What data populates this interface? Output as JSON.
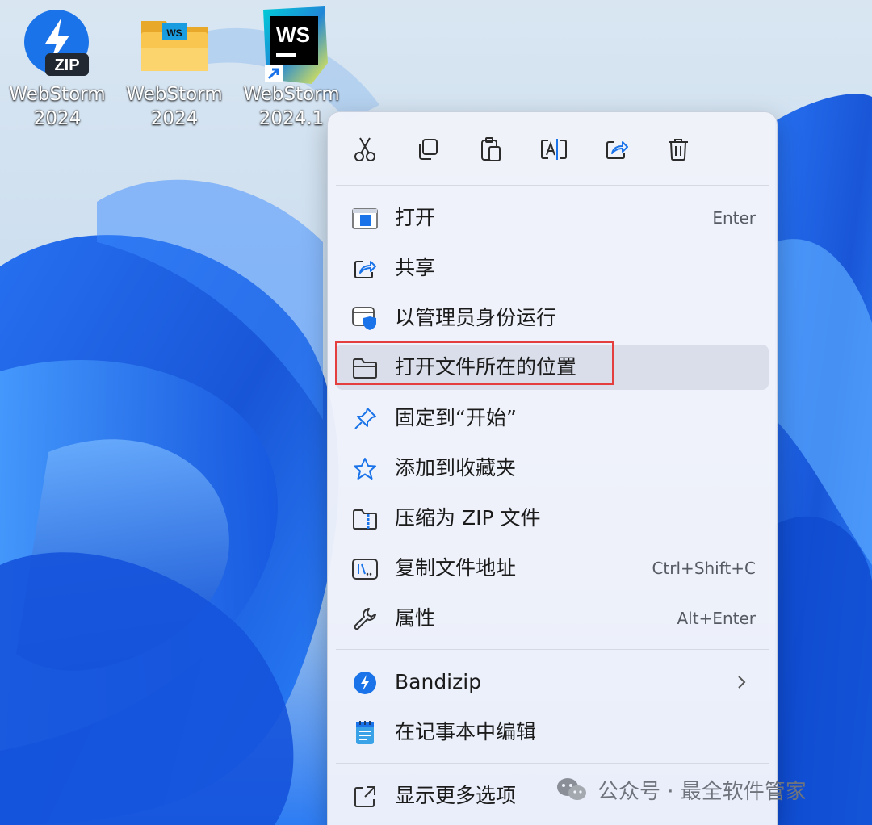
{
  "desktop": {
    "icons": [
      {
        "label": "WebStorm\n2024",
        "icon": "bandizip-zip-icon",
        "badge": "ZIP"
      },
      {
        "label": "WebStorm\n2024",
        "icon": "folder-icon",
        "badge": "WS"
      },
      {
        "label": "WebStorm\n2024.1",
        "icon": "webstorm-shortcut-icon",
        "badge": "WS"
      }
    ]
  },
  "context_menu": {
    "quick_actions": [
      {
        "name": "cut",
        "icon": "scissors-icon"
      },
      {
        "name": "copy",
        "icon": "copy-icon"
      },
      {
        "name": "paste",
        "icon": "paste-icon"
      },
      {
        "name": "rename",
        "icon": "rename-icon"
      },
      {
        "name": "share",
        "icon": "share-icon"
      },
      {
        "name": "delete",
        "icon": "trash-icon"
      }
    ],
    "items": [
      {
        "label": "打开",
        "shortcut": "Enter",
        "icon": "open-app-icon"
      },
      {
        "label": "共享",
        "shortcut": "",
        "icon": "share-icon"
      },
      {
        "label": "以管理员身份运行",
        "shortcut": "",
        "icon": "admin-shield-icon"
      },
      {
        "label": "打开文件所在的位置",
        "shortcut": "",
        "icon": "folder-open-icon"
      },
      {
        "label": "固定到“开始”",
        "shortcut": "",
        "icon": "pin-icon"
      },
      {
        "label": "添加到收藏夹",
        "shortcut": "",
        "icon": "star-icon"
      },
      {
        "label": "压缩为 ZIP 文件",
        "shortcut": "",
        "icon": "zip-folder-icon"
      },
      {
        "label": "复制文件地址",
        "shortcut": "Ctrl+Shift+C",
        "icon": "copy-path-icon"
      },
      {
        "label": "属性",
        "shortcut": "Alt+Enter",
        "icon": "wrench-icon"
      },
      {
        "label": "Bandizip",
        "shortcut": "",
        "icon": "bandizip-icon"
      },
      {
        "label": "在记事本中编辑",
        "shortcut": "",
        "icon": "notepad-icon"
      },
      {
        "label": "显示更多选项",
        "shortcut": "",
        "icon": "more-options-icon"
      }
    ]
  },
  "watermark": {
    "text": "公众号 · 最全软件管家"
  },
  "colors": {
    "accent": "#1a73e8",
    "highlight_border": "#e53e3e",
    "menu_bg": "#f0f3fa"
  }
}
